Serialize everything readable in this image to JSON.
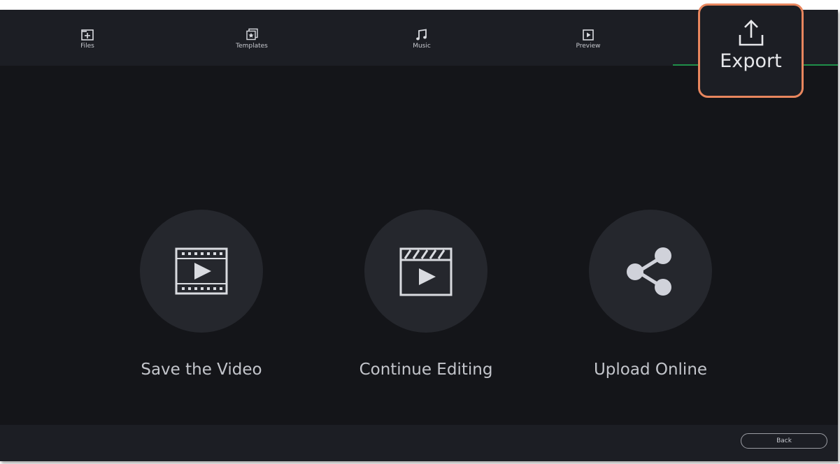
{
  "tabs": [
    {
      "label": "Files",
      "icon": "folder-plus-icon"
    },
    {
      "label": "Templates",
      "icon": "template-star-icon"
    },
    {
      "label": "Music",
      "icon": "music-note-icon"
    },
    {
      "label": "Preview",
      "icon": "play-preview-icon"
    }
  ],
  "export": {
    "label": "Export",
    "icon": "export-upload-icon",
    "accent": "#e8865e",
    "active_line": "#1f8f4a"
  },
  "options": [
    {
      "label": "Save the Video",
      "icon": "film-play-icon"
    },
    {
      "label": "Continue Editing",
      "icon": "clapperboard-play-icon"
    },
    {
      "label": "Upload Online",
      "icon": "share-icon"
    }
  ],
  "footer": {
    "back_label": "Back"
  }
}
